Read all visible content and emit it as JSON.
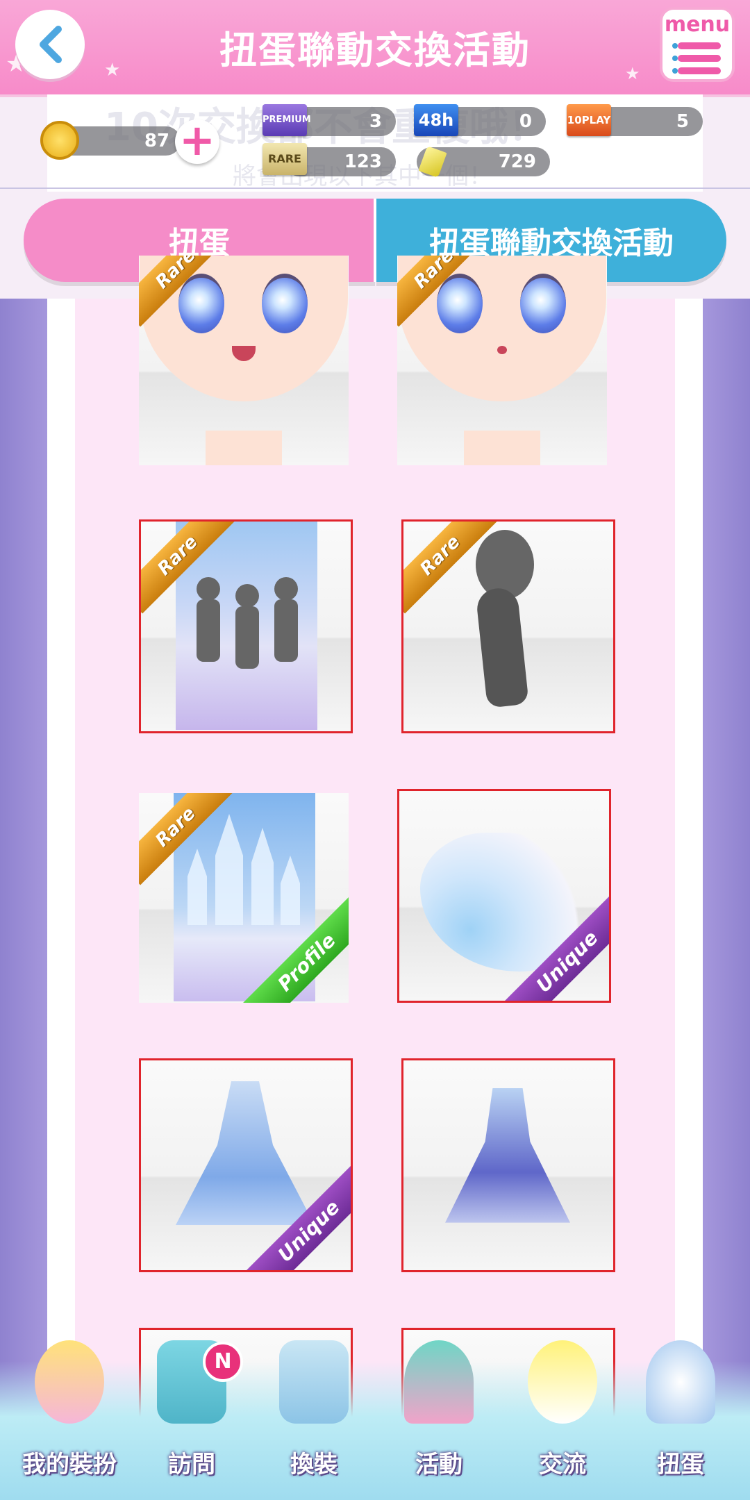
{
  "header": {
    "title": "扭蛋聯動交換活動",
    "menu_label": "menu"
  },
  "background_text": {
    "line1": "10次交換都不會重複哦！",
    "line2": "將會出現以下其中一個！"
  },
  "currency": {
    "coins": "87",
    "premium_ticket": "3",
    "ticket_48h": "0",
    "ticket_10play": "5",
    "rare_ticket": "123",
    "gems": "729"
  },
  "ticket_labels": {
    "premium": "PREMIUM",
    "t48h": "48h",
    "t10play": "10PLAY",
    "rare": "RARE"
  },
  "tabs": [
    {
      "label": "扭蛋"
    },
    {
      "label": "扭蛋聯動交換活動"
    }
  ],
  "badges": {
    "rare": "Rare",
    "unique": "Unique",
    "profile": "Profile"
  },
  "nav": [
    {
      "label": "我的裝扮"
    },
    {
      "label": "訪問"
    },
    {
      "label": "換裝"
    },
    {
      "label": "活動"
    },
    {
      "label": "交流"
    },
    {
      "label": "扭蛋"
    }
  ],
  "nav_badge": "N",
  "colors": {
    "header_pink": "#f78bc9",
    "tab_blue": "#3eb0da",
    "selection_red": "#e0242c"
  }
}
